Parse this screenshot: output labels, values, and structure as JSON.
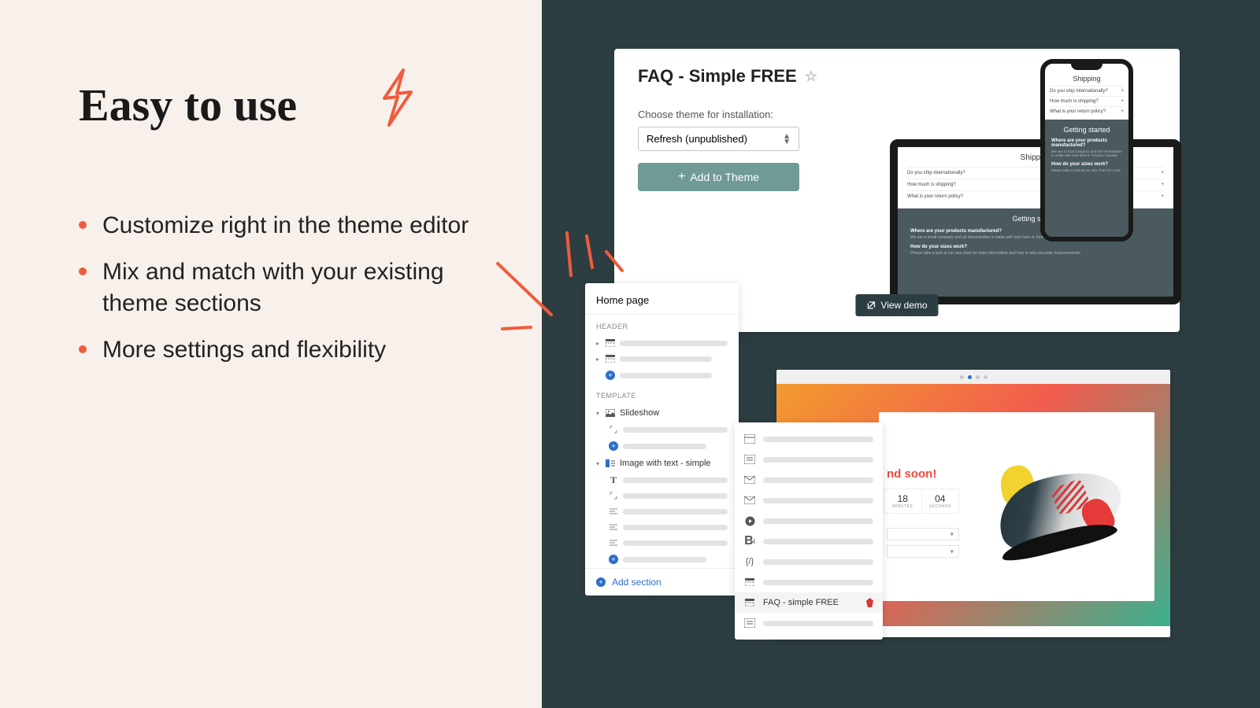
{
  "headline": "Easy to use",
  "bullets": [
    "Customize right in the theme editor",
    "Mix and match with your existing theme sections",
    "More settings and flexibility"
  ],
  "faq_card": {
    "title": "FAQ - Simple FREE",
    "choose_label": "Choose theme for installation:",
    "selected_theme": "Refresh (unpublished)",
    "add_button": "Add to Theme",
    "view_demo": "View demo"
  },
  "laptop": {
    "heading": "Shipping",
    "questions": [
      "Do you ship internationally?",
      "How much is shipping?",
      "What is your return policy?"
    ],
    "getting_started": "Getting started",
    "q1": "Where are your products manufactured?",
    "a1": "We are a small company and all merchandise is made with love here in Toronto, Canada.",
    "q2": "How do your sizes work?",
    "a2": "Please take a look at our size chart for more information and how to take accurate measurements."
  },
  "phone": {
    "heading": "Shipping",
    "questions": [
      "Do you ship internationally?",
      "How much is shipping?",
      "What is your return policy?"
    ],
    "getting_started": "Getting started",
    "q1": "Where are your products manufactured?",
    "a1": "We are a local company and all merchandise is made with love here in Toronto, Canada.",
    "q2": "How do your sizes work?",
    "a2": "Please take a look at our size chart for more"
  },
  "editor": {
    "title": "Home page",
    "header_label": "HEADER",
    "template_label": "TEMPLATE",
    "slideshow": "Slideshow",
    "image_text": "Image with text - simple",
    "add_section": "Add section"
  },
  "types": {
    "active_label": "FAQ - simple FREE"
  },
  "store": {
    "end_soon": "nd soon!",
    "timer": [
      {
        "num": "18",
        "label": "MINUTES"
      },
      {
        "num": "04",
        "label": "SECONDS"
      }
    ]
  },
  "colors": {
    "accent": "#ef5c3d",
    "dark": "#2d3e42",
    "teal_btn": "#6f9a96"
  }
}
